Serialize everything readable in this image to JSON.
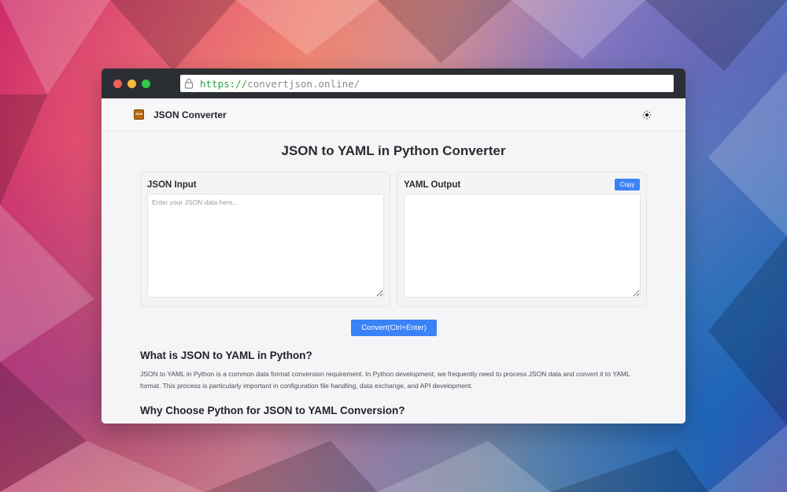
{
  "browser": {
    "url_scheme": "https://",
    "url_host": "convertjson.online/"
  },
  "navbar": {
    "brand": "JSON Converter",
    "logo_text": "JSON",
    "theme_icon": "sun-icon"
  },
  "main": {
    "title": "JSON to YAML in Python Converter",
    "input_panel": {
      "label": "JSON Input",
      "placeholder": "Enter your JSON data here..."
    },
    "output_panel": {
      "label": "YAML Output",
      "copy_label": "Copy"
    },
    "convert_label": "Convert(Ctrl+Enter)"
  },
  "content": {
    "heading1": "What is JSON to YAML in Python?",
    "paragraph1": "JSON to YAML in Python is a common data format conversion requirement. In Python development, we frequently need to process JSON data and convert it to YAML format. This process is particularly important in configuration file handling, data exchange, and API development.",
    "heading2": "Why Choose Python for JSON to YAML Conversion?"
  },
  "colors": {
    "accent": "#3b82f6",
    "titlebar": "#2b2f33",
    "url_scheme": "#27a348"
  }
}
